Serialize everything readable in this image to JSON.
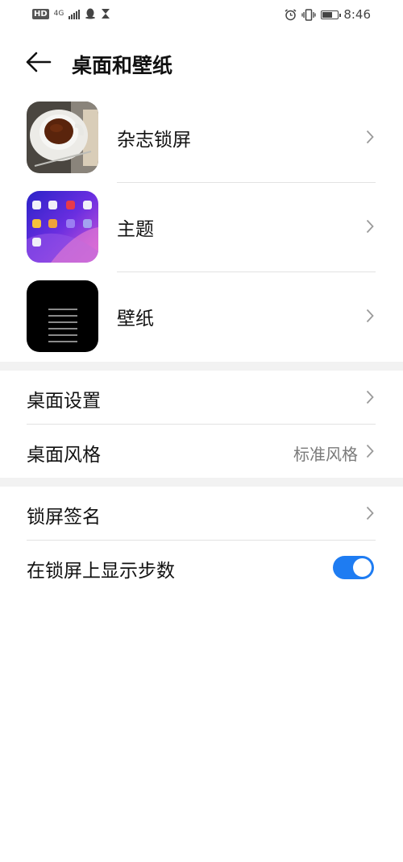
{
  "status_bar": {
    "hd": "HD",
    "network": "4G",
    "time": "8:46",
    "battery_percent": 70
  },
  "header": {
    "title": "桌面和壁纸"
  },
  "theme_items": [
    {
      "label": "杂志锁屏",
      "icon": "coffee-cup-photo"
    },
    {
      "label": "主题",
      "icon": "theme-preview"
    },
    {
      "label": "壁纸",
      "icon": "wallpaper-preview"
    }
  ],
  "desktop_settings": {
    "label": "桌面设置"
  },
  "desktop_style": {
    "label": "桌面风格",
    "value": "标准风格"
  },
  "lock_signature": {
    "label": "锁屏签名"
  },
  "show_steps": {
    "label": "在锁屏上显示步数",
    "enabled": true
  },
  "colors": {
    "accent": "#1e7cf2",
    "separator": "#e2e2e2",
    "section_gap": "#f2f2f2"
  }
}
